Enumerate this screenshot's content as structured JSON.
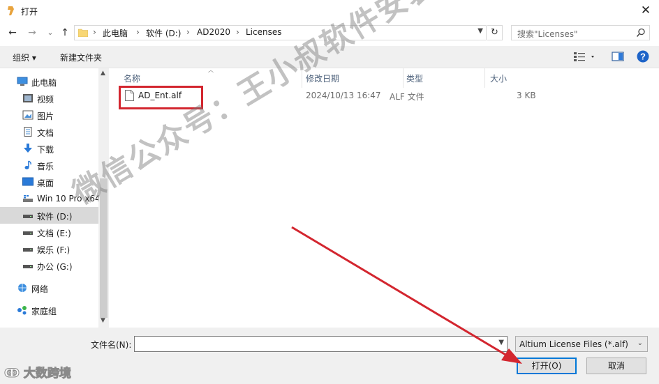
{
  "window": {
    "title": "打开",
    "close_glyph": "✕"
  },
  "nav": {
    "back_glyph": "←",
    "forward_glyph": "→",
    "recent_glyph": "⌄",
    "up_glyph": "↑"
  },
  "breadcrumb": {
    "items": [
      "此电脑",
      "软件 (D:)",
      "AD2020",
      "Licenses"
    ],
    "separator": "›"
  },
  "search": {
    "placeholder": "搜索\"Licenses\""
  },
  "toolbar": {
    "organize_label": "组织 ▾",
    "new_folder_label": "新建文件夹"
  },
  "sidebar": {
    "items": [
      {
        "label": "此电脑",
        "icon": "computer-icon"
      },
      {
        "label": "视频",
        "icon": "video-folder-icon"
      },
      {
        "label": "图片",
        "icon": "pictures-folder-icon"
      },
      {
        "label": "文档",
        "icon": "documents-folder-icon"
      },
      {
        "label": "下载",
        "icon": "download-icon"
      },
      {
        "label": "音乐",
        "icon": "music-icon"
      },
      {
        "label": "桌面",
        "icon": "desktop-icon"
      },
      {
        "label": "Win 10 Pro x64",
        "icon": "drive-icon"
      },
      {
        "label": "软件 (D:)",
        "icon": "drive-icon"
      },
      {
        "label": "文档 (E:)",
        "icon": "drive-icon"
      },
      {
        "label": "娱乐 (F:)",
        "icon": "drive-icon"
      },
      {
        "label": "办公 (G:)",
        "icon": "drive-icon"
      },
      {
        "label": "网络",
        "icon": "network-icon"
      },
      {
        "label": "家庭组",
        "icon": "homegroup-icon"
      }
    ],
    "selected_index": 8
  },
  "columns": {
    "name": "名称",
    "date": "修改日期",
    "type": "类型",
    "size": "大小"
  },
  "files": [
    {
      "name": "AD_Ent.alf",
      "date": "2024/10/13 16:47",
      "type": "ALF 文件",
      "size": "3 KB"
    }
  ],
  "bottom": {
    "filename_label": "文件名(N):",
    "filename_value": "",
    "filter_label": "Altium License Files (*.alf)",
    "open_label": "打开(O)",
    "cancel_label": "取消"
  },
  "overlays": {
    "watermark_text": "微信公众号：王小叔软件安装",
    "corner_logo_text": "大数跨境"
  },
  "colors": {
    "highlight_red": "#d3262f",
    "accent_blue": "#0078d7",
    "folder_yellow": "#f8d775"
  }
}
